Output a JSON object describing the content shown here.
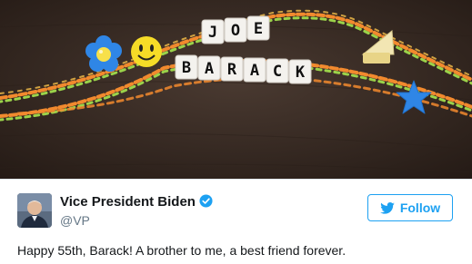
{
  "media": {
    "alt_kind": "friendship-bracelets-photo",
    "bead_words": [
      "JOE",
      "BARACK"
    ],
    "colors": {
      "table": "#3a2c25",
      "thread_orange": "#f28a2e",
      "thread_green": "#9bd34a",
      "bead_white": "#f4f2ee",
      "star_blue": "#2f86e6"
    }
  },
  "author": {
    "name": "Vice President Biden",
    "handle": "@VP",
    "verified": true,
    "verified_icon": "verified-badge-icon",
    "avatar_icon": "profile-photo"
  },
  "follow_button": {
    "label": "Follow",
    "icon": "twitter-bird-icon",
    "color": "#1da1f2"
  },
  "tweet": {
    "text": "Happy 55th, Barack! A brother to me, a best friend forever."
  }
}
